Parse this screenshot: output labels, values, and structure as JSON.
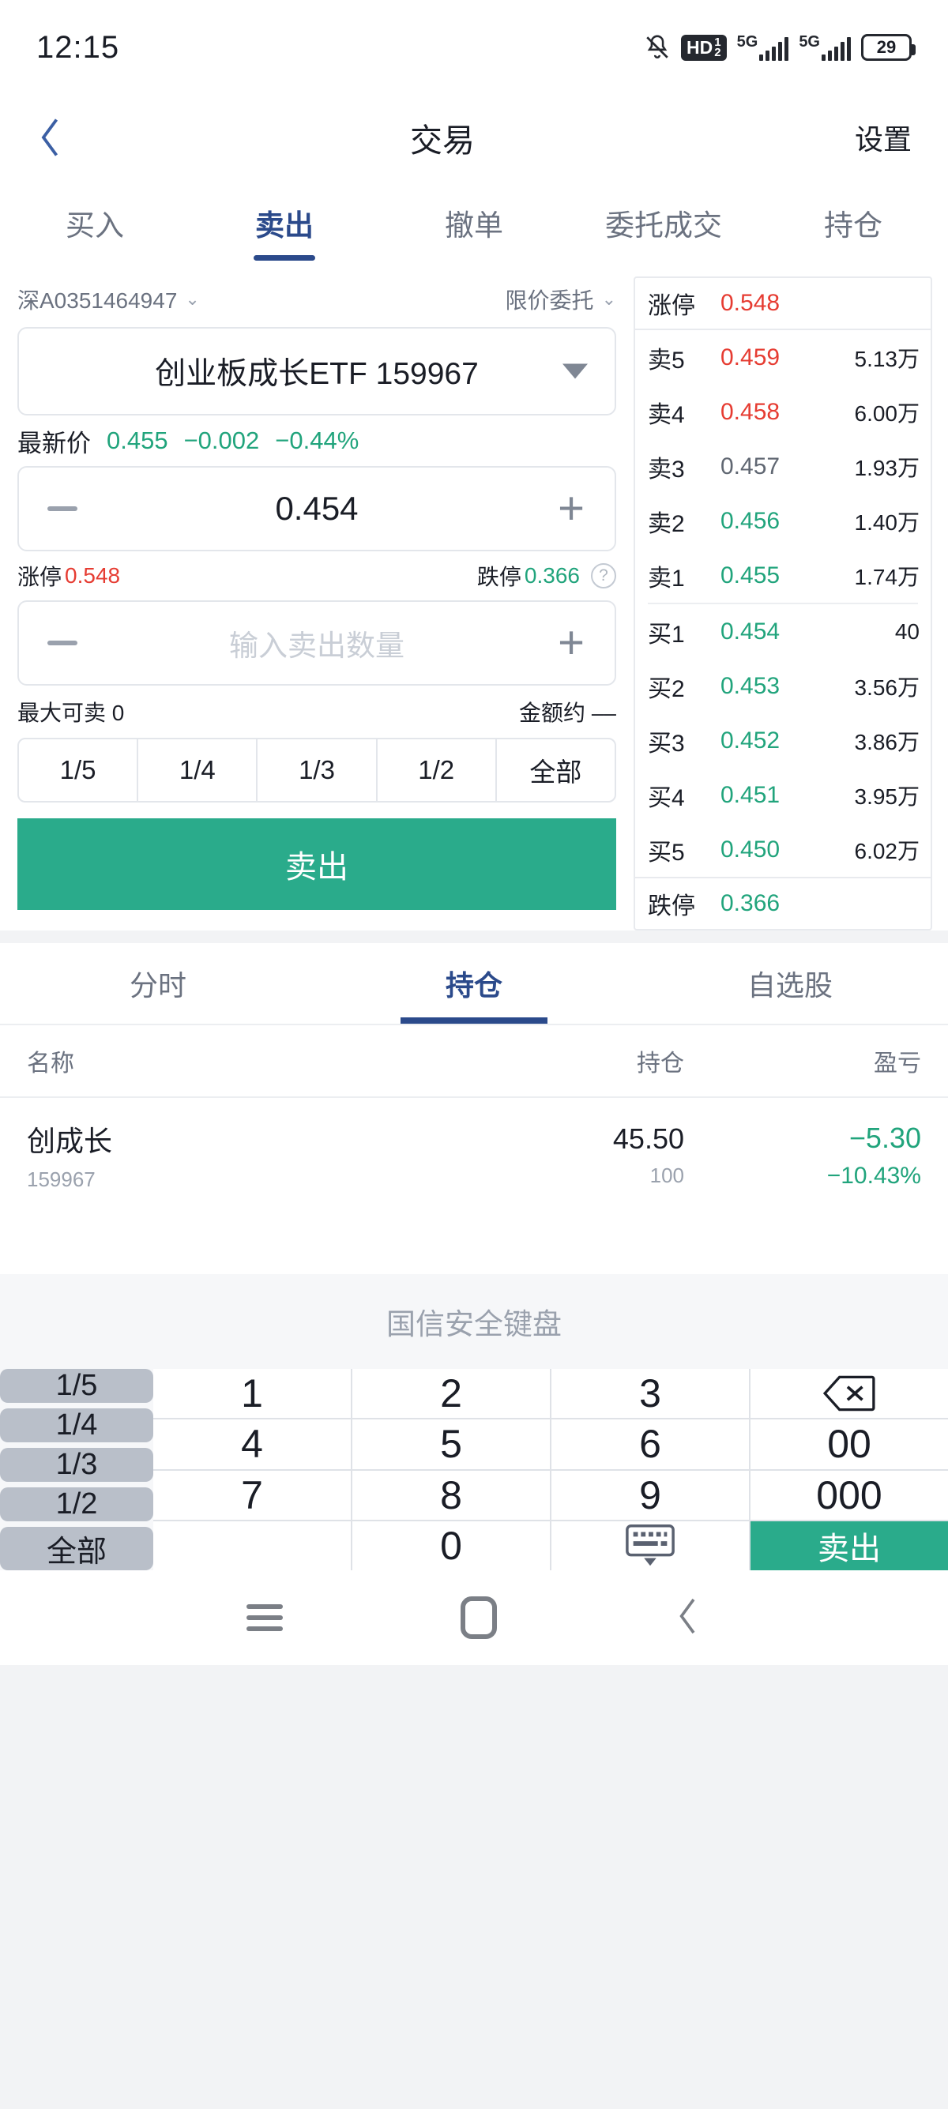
{
  "status_bar": {
    "time": "12:15",
    "hd_label": "HD",
    "hd_sub1": "1",
    "hd_sub2": "2",
    "net1": "5G",
    "net2": "5G",
    "battery": "29",
    "icons": [
      "bell-muted-icon",
      "hd-volte-icon",
      "signal-5g-icon",
      "signal-5g-icon",
      "battery-icon"
    ]
  },
  "header": {
    "back": "‹",
    "title": "交易",
    "settings": "设置"
  },
  "tabs": [
    {
      "label": "买入",
      "active": false
    },
    {
      "label": "卖出",
      "active": true
    },
    {
      "label": "撤单",
      "active": false
    },
    {
      "label": "委托成交",
      "active": false
    },
    {
      "label": "持仓",
      "active": false
    }
  ],
  "order": {
    "account": "深A0351464947",
    "order_type": "限价委托",
    "stock": "创业板成长ETF 159967",
    "latest_label": "最新价",
    "latest_price": "0.455",
    "latest_change": "−0.002",
    "latest_pct": "−0.44%",
    "price_value": "0.454",
    "minus": "−",
    "plus": "+",
    "up_limit_label": "涨停",
    "up_limit": "0.548",
    "down_limit_label": "跌停",
    "down_limit": "0.366",
    "help": "?",
    "qty_placeholder": "输入卖出数量",
    "max_label": "最大可卖",
    "max_value": "0",
    "amount_label": "金额约",
    "amount_value": "––",
    "fractions": [
      "1/5",
      "1/4",
      "1/3",
      "1/2",
      "全部"
    ],
    "sell_button": "卖出"
  },
  "order_book": {
    "cap_top_label": "涨停",
    "cap_top_value": "0.548",
    "cap_bottom_label": "跌停",
    "cap_bottom_value": "0.366",
    "rows": [
      {
        "label": "卖5",
        "price": "0.459",
        "vol": "5.13万",
        "color": "red"
      },
      {
        "label": "卖4",
        "price": "0.458",
        "vol": "6.00万",
        "color": "red"
      },
      {
        "label": "卖3",
        "price": "0.457",
        "vol": "1.93万",
        "color": "grey"
      },
      {
        "label": "卖2",
        "price": "0.456",
        "vol": "1.40万",
        "color": "green"
      },
      {
        "label": "卖1",
        "price": "0.455",
        "vol": "1.74万",
        "color": "green"
      },
      {
        "label": "买1",
        "price": "0.454",
        "vol": "40",
        "color": "green"
      },
      {
        "label": "买2",
        "price": "0.453",
        "vol": "3.56万",
        "color": "green"
      },
      {
        "label": "买3",
        "price": "0.452",
        "vol": "3.86万",
        "color": "green"
      },
      {
        "label": "买4",
        "price": "0.451",
        "vol": "3.95万",
        "color": "green"
      },
      {
        "label": "买5",
        "price": "0.450",
        "vol": "6.02万",
        "color": "green"
      }
    ]
  },
  "position": {
    "tabs": [
      {
        "label": "分时",
        "active": false
      },
      {
        "label": "持仓",
        "active": true
      },
      {
        "label": "自选股",
        "active": false
      }
    ],
    "columns": [
      "名称",
      "持仓",
      "盈亏"
    ],
    "rows": [
      {
        "name": "创成长",
        "code": "159967",
        "qty": "45.50",
        "qty_sub": "100",
        "pnl": "−5.30",
        "pnl_pct": "−10.43%"
      }
    ]
  },
  "keyboard": {
    "title": "国信安全键盘",
    "side_keys": [
      "1/5",
      "1/4",
      "1/3",
      "1/2",
      "全部"
    ],
    "keys": [
      {
        "label": "1",
        "type": "num"
      },
      {
        "label": "2",
        "type": "num"
      },
      {
        "label": "3",
        "type": "num"
      },
      {
        "label": "⌫",
        "type": "backspace"
      },
      {
        "label": "4",
        "type": "num"
      },
      {
        "label": "5",
        "type": "num"
      },
      {
        "label": "6",
        "type": "num"
      },
      {
        "label": "00",
        "type": "num"
      },
      {
        "label": "7",
        "type": "num"
      },
      {
        "label": "8",
        "type": "num"
      },
      {
        "label": "9",
        "type": "num"
      },
      {
        "label": "000",
        "type": "num"
      },
      {
        "label": "",
        "type": "blank"
      },
      {
        "label": "0",
        "type": "num"
      },
      {
        "label": "⌨",
        "type": "hide"
      },
      {
        "label": "卖出",
        "type": "sell"
      }
    ]
  },
  "nav_bar": {
    "menu": "menu-icon",
    "home": "home-icon",
    "back": "back-icon"
  },
  "colors": {
    "accent_blue": "#2b4a8b",
    "sell_green": "#2aab8b",
    "up_red": "#e63c32",
    "down_green": "#21a47c"
  }
}
